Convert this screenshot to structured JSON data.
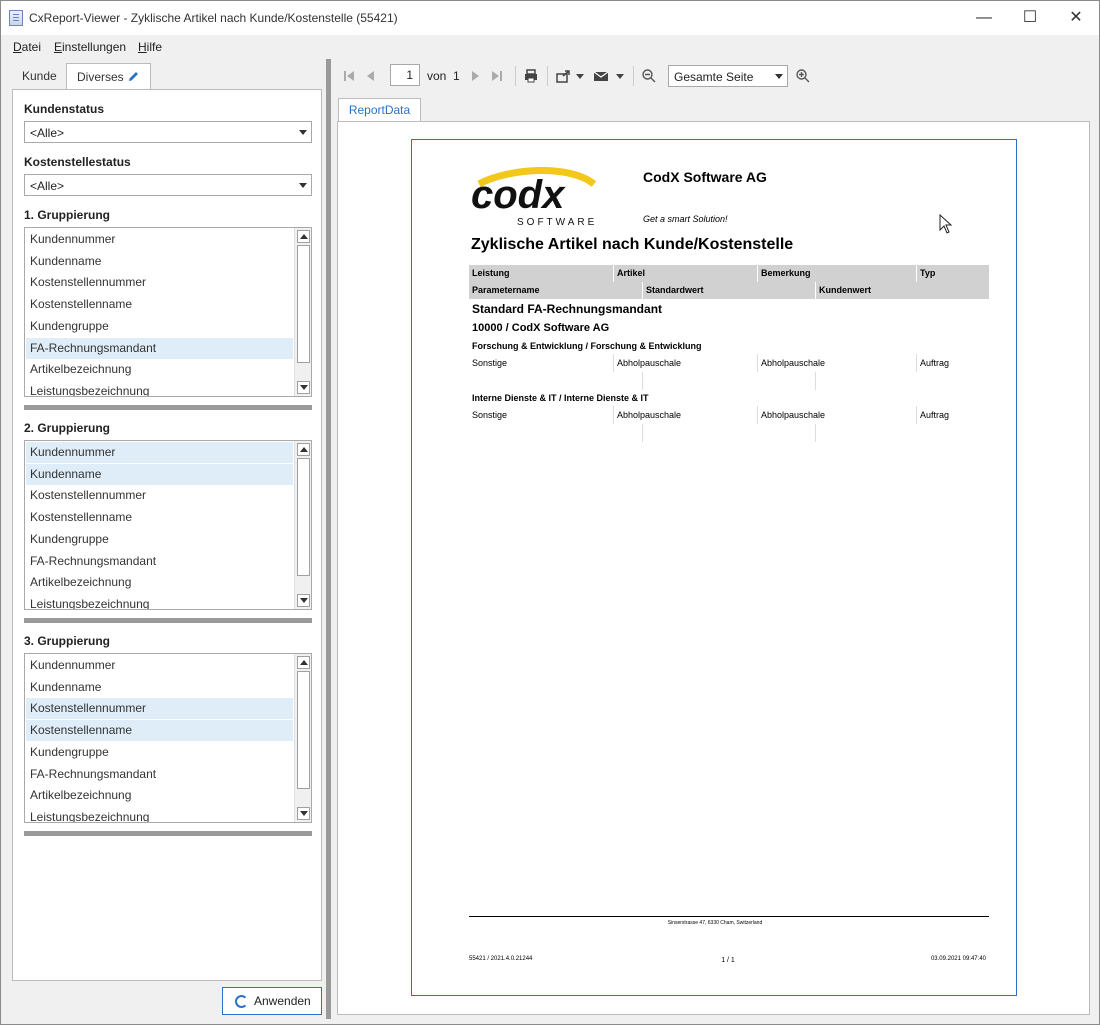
{
  "window": {
    "title": "CxReport-Viewer - Zyklische Artikel nach Kunde/Kostenstelle (55421)",
    "minimize": "—",
    "maximize": "☐",
    "close": "✕"
  },
  "menu": {
    "datei_first": "D",
    "datei_rest": "atei",
    "einst_first": "E",
    "einst_rest": "instellungen",
    "hilfe_first": "H",
    "hilfe_rest": "ilfe"
  },
  "tabs": {
    "kunde": "Kunde",
    "diverses": "Diverses"
  },
  "filters": {
    "kundenstatus_label": "Kundenstatus",
    "kundenstatus_value": "<Alle>",
    "kostenstellestatus_label": "Kostenstellestatus",
    "kostenstellestatus_value": "<Alle>"
  },
  "groupings": [
    {
      "label": "1. Gruppierung",
      "items": [
        "Kundennummer",
        "Kundenname",
        "Kostenstellennummer",
        "Kostenstellenname",
        "Kundengruppe",
        "FA-Rechnungsmandant",
        "Artikelbezeichnung",
        "Leistungsbezeichnung"
      ],
      "selected": [
        5
      ]
    },
    {
      "label": "2. Gruppierung",
      "items": [
        "Kundennummer",
        "Kundenname",
        "Kostenstellennummer",
        "Kostenstellenname",
        "Kundengruppe",
        "FA-Rechnungsmandant",
        "Artikelbezeichnung",
        "Leistungsbezeichnung"
      ],
      "selected": [
        0,
        1
      ]
    },
    {
      "label": "3. Gruppierung",
      "items": [
        "Kundennummer",
        "Kundenname",
        "Kostenstellennummer",
        "Kostenstellenname",
        "Kundengruppe",
        "FA-Rechnungsmandant",
        "Artikelbezeichnung",
        "Leistungsbezeichnung"
      ],
      "selected": [
        2,
        3
      ]
    }
  ],
  "apply_button": "Anwenden",
  "toolbar": {
    "page_current": "1",
    "page_of": "von",
    "page_total": "1",
    "zoom_value": "Gesamte Seite"
  },
  "report_tab": "ReportData",
  "report": {
    "logo_text": "codx",
    "logo_sub": "SOFTWARE",
    "company": "CodX Software AG",
    "slogan": "Get a smart Solution!",
    "title": "Zyklische Artikel nach Kunde/Kostenstelle",
    "header1": [
      "Leistung",
      "Artikel",
      "Bemerkung",
      "Typ"
    ],
    "header2": [
      "Parametername",
      "Standardwert",
      "Kundenwert"
    ],
    "group1": "Standard FA-Rechnungsmandant",
    "group2": "10000 / CodX Software AG",
    "sections": [
      {
        "title": "Forschung & Entwicklung / Forschung & Entwicklung",
        "row": [
          "Sonstige",
          "Abholpauschale",
          "Abholpauschale",
          "Auftrag"
        ]
      },
      {
        "title": "Interne Dienste & IT / Interne Dienste & IT",
        "row": [
          "Sonstige",
          "Abholpauschale",
          "Abholpauschale",
          "Auftrag"
        ]
      }
    ],
    "footer_address": "Sinserstrasse 47, 6330 Cham, Switzerland",
    "footer_left": "55421 / 2021.4.0.21244",
    "footer_center": "1 / 1",
    "footer_right": "03.09.2021 09:47:40"
  },
  "colors": {
    "accent": "#2b72c5",
    "selection": "#dfedf9",
    "header_gray": "#d1d1d1",
    "logo_yellow": "#f2c81b"
  }
}
